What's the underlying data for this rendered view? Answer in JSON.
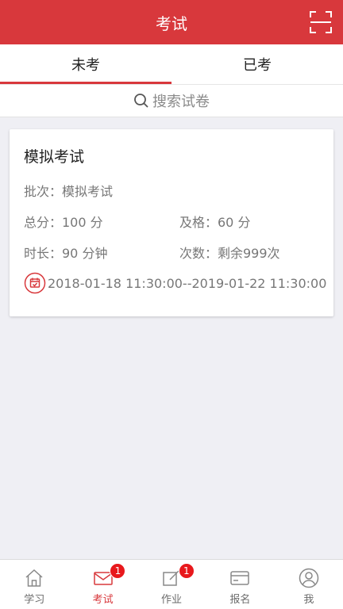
{
  "header": {
    "title": "考试",
    "scan_icon": "scan-icon"
  },
  "tabs": [
    {
      "label": "未考",
      "active": true
    },
    {
      "label": "已考",
      "active": false
    }
  ],
  "search": {
    "placeholder": "搜索试卷",
    "icon": "search-icon"
  },
  "exam_card": {
    "title": "模拟考试",
    "batch": "批次：模拟考试",
    "total_score": "总分：100 分",
    "pass_score": "及格：60 分",
    "duration": "时长：90 分钟",
    "attempts": "次数：剩余999次",
    "date_range": "2018-01-18 11:30:00--2019-01-22 11:30:00",
    "calendar_icon": "calendar-icon"
  },
  "tabbar": [
    {
      "label": "学习",
      "icon": "home-icon",
      "badge": ""
    },
    {
      "label": "考试",
      "icon": "mail-icon",
      "badge": "1",
      "active": true
    },
    {
      "label": "作业",
      "icon": "edit-icon",
      "badge": "1"
    },
    {
      "label": "报名",
      "icon": "card-icon",
      "badge": ""
    },
    {
      "label": "我",
      "icon": "user-icon",
      "badge": ""
    }
  ],
  "colors": {
    "accent": "#d8383c",
    "badge": "#e8181c",
    "background": "#efeff4"
  }
}
